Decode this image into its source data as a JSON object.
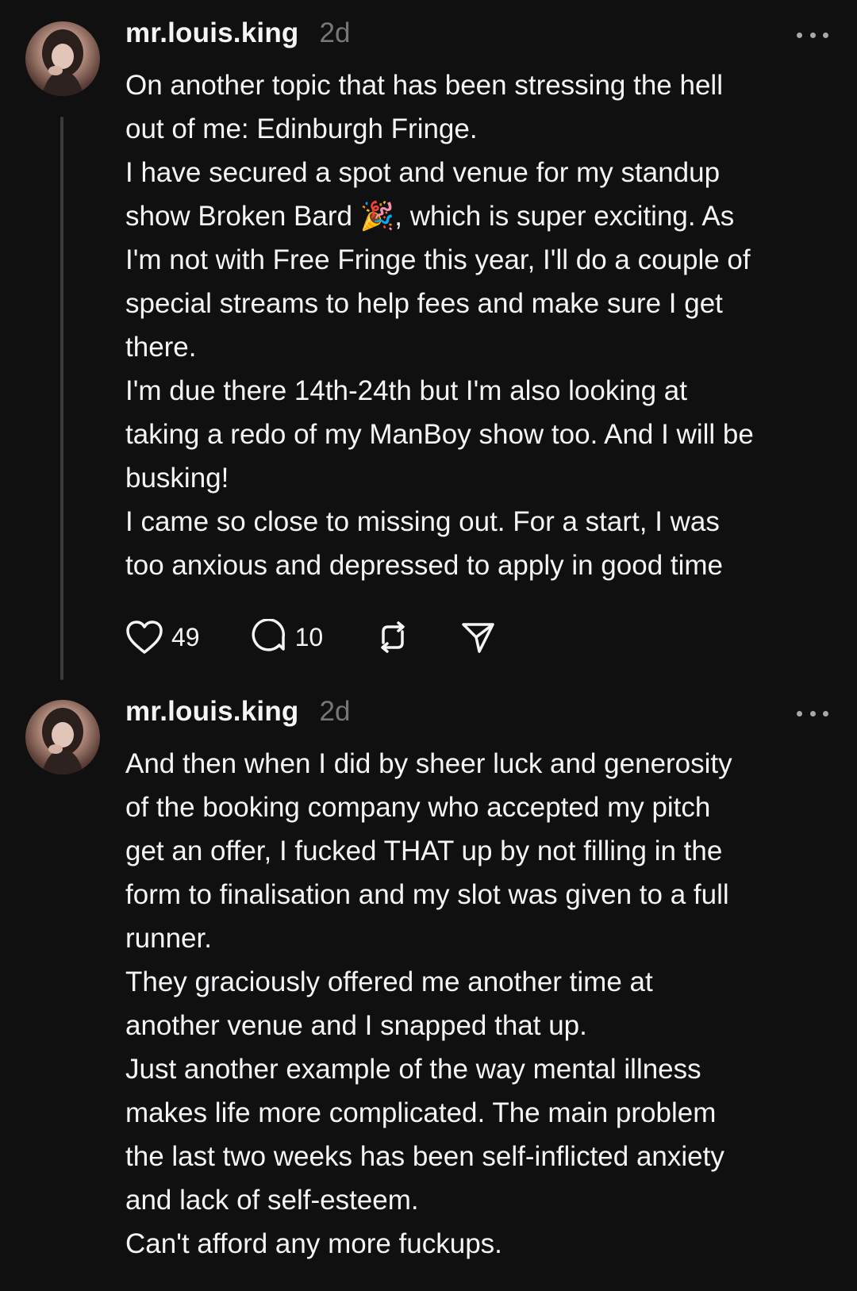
{
  "posts": [
    {
      "username": "mr.louis.king",
      "time": "2d",
      "lines": [
        "On another topic that has been stressing the hell",
        "out of me: Edinburgh Fringe.",
        "I have secured a spot and venue for my standup",
        "show Broken Bard 🎉, which is super exciting. As",
        "I'm not with Free Fringe this year, I'll do a couple of",
        "special streams to help fees and make sure I get",
        "there.",
        "I'm due there 14th-24th but I'm also looking at",
        "taking a redo of my ManBoy show too. And I will be",
        "busking!",
        "I came so close to missing out. For a start, I was",
        "too anxious and depressed to apply in good time"
      ],
      "likes": "49",
      "replies": "10",
      "icons": [
        "heart-icon",
        "comment-icon",
        "repost-icon",
        "share-icon"
      ]
    },
    {
      "username": "mr.louis.king",
      "time": "2d",
      "lines": [
        "And then when I did by sheer luck and generosity",
        "of the booking company who accepted my pitch",
        "get an offer, I fucked THAT up by not filling in the",
        "form to finalisation and my slot was given to a full",
        "runner.",
        "They graciously offered me another time at",
        "another venue and I snapped that up.",
        "Just another example of the way mental illness",
        "makes life more complicated. The main problem",
        "the last two weeks has been self-inflicted anxiety",
        "and lack of self-esteem.",
        "Can't afford any more fuckups."
      ]
    }
  ],
  "colors": {
    "background": "#101010",
    "text": "#f3f5f7",
    "muted": "#777777",
    "thread_line": "#3a3a3a"
  }
}
